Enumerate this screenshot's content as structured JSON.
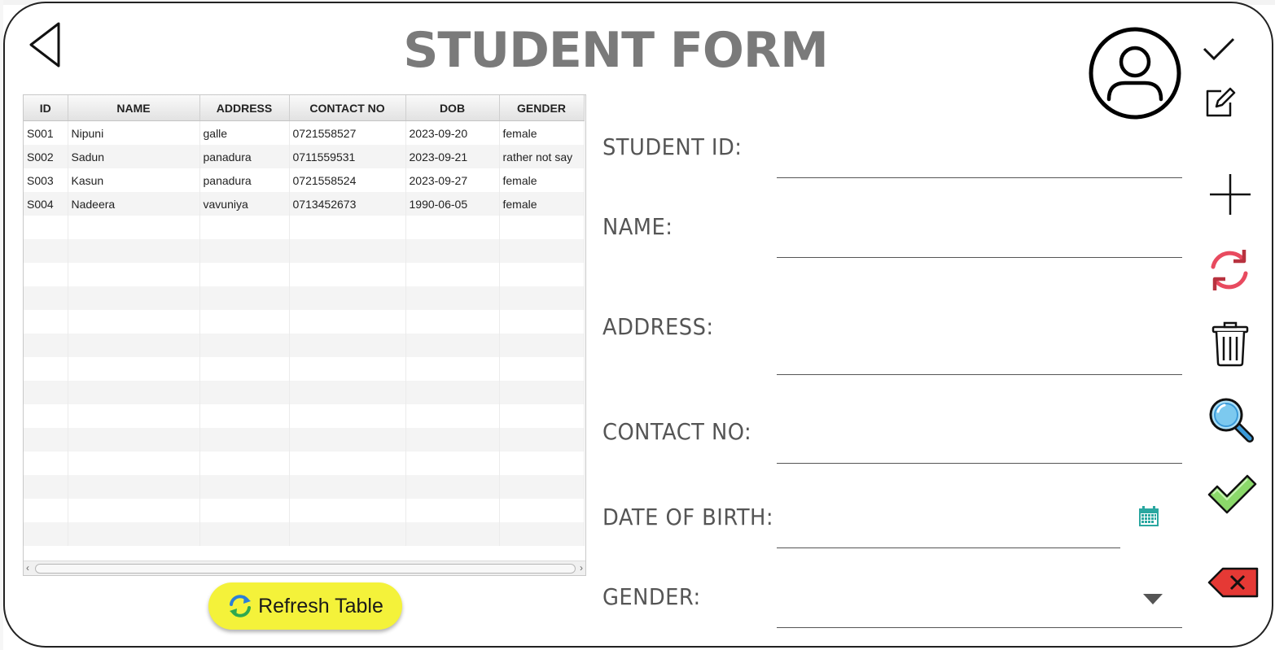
{
  "title": "STUDENT FORM",
  "table": {
    "columns": [
      "ID",
      "NAME",
      "ADDRESS",
      "CONTACT NO",
      "DOB",
      "GENDER"
    ],
    "rows": [
      [
        "S001",
        "Nipuni",
        "galle",
        "0721558527",
        "2023-09-20",
        "female"
      ],
      [
        "S002",
        "Sadun",
        "panadura",
        "0711559531",
        "2023-09-21",
        "rather not say"
      ],
      [
        "S003",
        "Kasun",
        "panadura",
        "0721558524",
        "2023-09-27",
        "female"
      ],
      [
        "S004",
        "Nadeera",
        "vavuniya",
        "0713452673",
        "1990-06-05",
        "female"
      ]
    ]
  },
  "refresh_button": {
    "label": "Refresh Table",
    "icon": "refresh-icon"
  },
  "form": {
    "student_id_label": "STUDENT ID:",
    "name_label": "NAME:",
    "address_label": "ADDRESS:",
    "contact_label": "CONTACT NO:",
    "dob_label": "DATE OF BIRTH:",
    "gender_label": "GENDER:",
    "student_id_value": "",
    "name_value": "",
    "address_value": "",
    "contact_value": "",
    "dob_value": "",
    "gender_value": ""
  },
  "toolbar": {
    "icons": [
      "back-arrow-icon",
      "user-avatar-icon",
      "checkmark-icon",
      "edit-icon",
      "add-icon",
      "reload-icon",
      "trash-icon",
      "search-icon",
      "confirm-check-icon",
      "clear-icon",
      "calendar-icon",
      "dropdown-arrow-icon"
    ]
  },
  "colors": {
    "title": "#7a7a7a",
    "refresh_button_bg": "#f4f23a",
    "reload_icon": "#e84a5f",
    "search_icon": "#3a9ad9",
    "confirm_icon": "#8bd96a",
    "clear_icon": "#e53935",
    "calendar_icon": "#2aa7a0"
  }
}
